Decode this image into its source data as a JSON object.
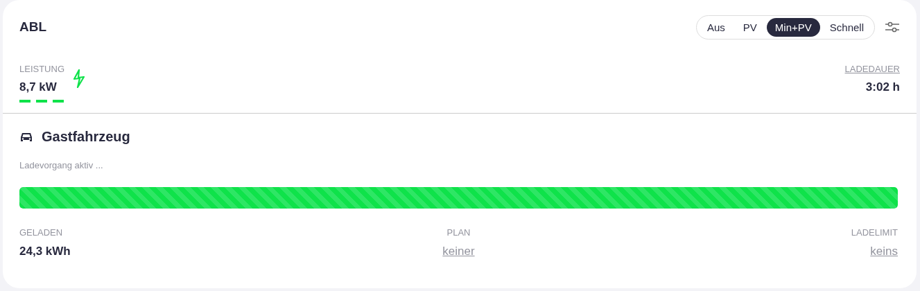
{
  "title": "ABL",
  "modes": [
    {
      "label": "Aus",
      "selected": false
    },
    {
      "label": "PV",
      "selected": false
    },
    {
      "label": "Min+PV",
      "selected": true
    },
    {
      "label": "Schnell",
      "selected": false
    }
  ],
  "power": {
    "label": "LEISTUNG",
    "value": "8,7 kW",
    "charging": true
  },
  "duration": {
    "label": "LADEDAUER",
    "value": "3:02 h"
  },
  "vehicle": {
    "name": "Gastfahrzeug",
    "status": "Ladevorgang aktiv ...",
    "level": 1
  },
  "stats": [
    {
      "label": "GELADEN",
      "value": "24,3 kWh",
      "kind": "value"
    },
    {
      "label": "PLAN",
      "value": "keiner",
      "kind": "link"
    },
    {
      "label": "LADELIMIT",
      "value": "keins",
      "kind": "link"
    }
  ]
}
